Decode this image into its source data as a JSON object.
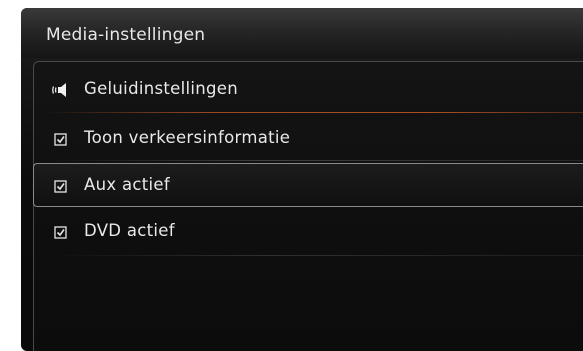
{
  "screen": {
    "title": "Media-instellingen"
  },
  "menu": {
    "items": [
      {
        "label": "Geluidinstellingen",
        "icon": "speaker-icon"
      },
      {
        "label": "Toon verkeersinformatie",
        "icon": "checkbox-checked-icon",
        "checked": true
      },
      {
        "label": "Aux actief",
        "icon": "checkbox-checked-icon",
        "checked": true,
        "selected": true
      },
      {
        "label": "DVD actief",
        "icon": "checkbox-checked-icon",
        "checked": true
      }
    ]
  },
  "colors": {
    "accent_divider": "#c85a28",
    "text": "#e9e9e9",
    "background": "#0c0c0c"
  }
}
